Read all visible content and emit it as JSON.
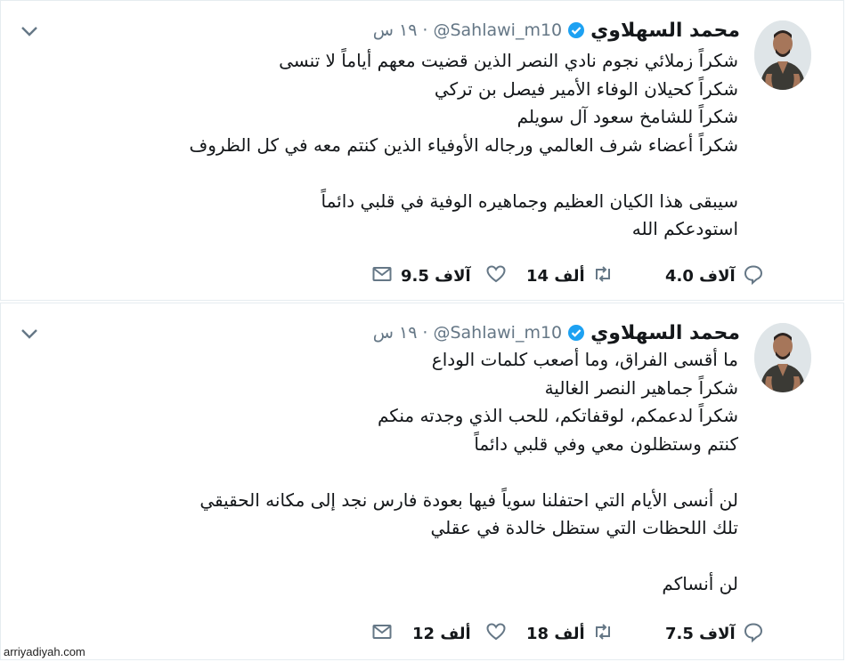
{
  "tweets": [
    {
      "author": "محمد السهلاوي",
      "handle": "@Sahlawi_m10",
      "separator": "·",
      "time": "١٩ س",
      "lines": [
        "شكراً زملائي نجوم نادي النصر الذين قضيت معهم أياماً لا تنسى",
        "شكراً كحيلان الوفاء الأمير فيصل بن تركي",
        "شكراً للشامخ سعود آل سويلم",
        "شكراً أعضاء شرف العالمي ورجاله الأوفياء الذين كنتم معه في كل الظروف",
        "",
        "سيبقى هذا الكيان العظيم وجماهيره الوفية في قلبي دائماً",
        "استودعكم الله"
      ],
      "actions": {
        "reply": "4.0 آلاف",
        "retweet": "14 ألف",
        "like": "9.5 آلاف",
        "message": ""
      }
    },
    {
      "author": "محمد السهلاوي",
      "handle": "@Sahlawi_m10",
      "separator": "·",
      "time": "١٩ س",
      "lines": [
        "ما أقسى الفراق، وما أصعب كلمات الوداع",
        "شكراً جماهير النصر الغالية",
        "شكراً لدعمكم، لوقفاتكم، للحب الذي وجدته منكم",
        "كنتم وستظلون معي وفي قلبي دائماً",
        "",
        "لن أنسى الأيام التي احتفلنا سوياً فيها بعودة فارس نجد إلى مكانه الحقيقي",
        "تلك اللحظات التي ستظل خالدة في عقلي",
        "",
        "لن أنساكم"
      ],
      "actions": {
        "reply": "7.5 آلاف",
        "retweet": "18 ألف",
        "like": "12 ألف",
        "message": ""
      }
    }
  ],
  "icons": {
    "verified": "verified-badge-icon",
    "chevron": "chevron-down-icon",
    "reply": "reply-icon",
    "retweet": "retweet-icon",
    "like": "like-heart-icon",
    "message": "direct-message-icon"
  },
  "colors": {
    "text": "#14171a",
    "muted": "#657786",
    "verified": "#1da1f2",
    "border": "#e6ecf0"
  },
  "watermark": "arriyadiyah.com"
}
